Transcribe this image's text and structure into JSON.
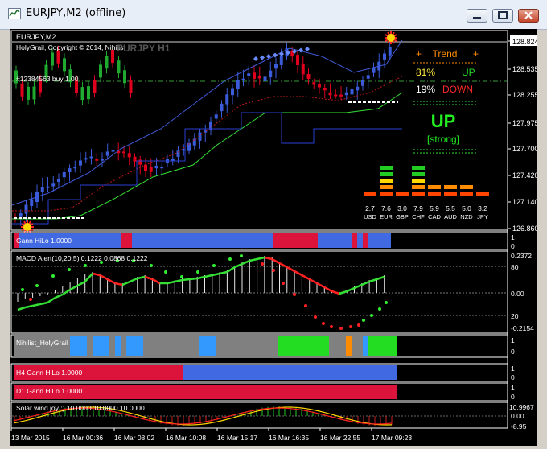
{
  "window": {
    "title": "EURJPY,M2 (offline)"
  },
  "chart_header": {
    "symbol": "EURJPY,M2",
    "indicator_label": "HolyGrail, Copyright © 2014, Nihilist",
    "watermark": "EURJPY H1",
    "order_line": "#12384563 buy 1.00"
  },
  "price_axis": {
    "labels": [
      "128.824",
      "128.535",
      "128.255",
      "127.975",
      "127.700",
      "127.420",
      "127.140",
      "126.860"
    ],
    "current_price": "128.824"
  },
  "trend_panel": {
    "title": "Trend",
    "plus": "+",
    "up_pct": "81%",
    "up_label": "UP",
    "down_pct": "19%",
    "down_label": "DOWN",
    "big_label": "UP",
    "strength": "[strong]"
  },
  "currency_strength": [
    {
      "value": "2.7",
      "ccy": "USD",
      "level": 1
    },
    {
      "value": "7.6",
      "ccy": "EUR",
      "level": 5
    },
    {
      "value": "3.0",
      "ccy": "GBP",
      "level": 1
    },
    {
      "value": "7.9",
      "ccy": "CHF",
      "level": 5
    },
    {
      "value": "5.9",
      "ccy": "CAD",
      "level": 2
    },
    {
      "value": "5.5",
      "ccy": "AUD",
      "level": 2
    },
    {
      "value": "5.0",
      "ccy": "NZD",
      "level": 2
    },
    {
      "value": "3.2",
      "ccy": "JPY",
      "level": 1
    }
  ],
  "subwindows": {
    "gann": {
      "label": "Gann HiLo 1.0000",
      "scale_top": "1",
      "scale_bottom": "0"
    },
    "macd": {
      "label": "MACD Alert(10,20,5) 0.1222 0.0868 0.1222",
      "scale": [
        "0.2372",
        "80",
        "0.00",
        "20",
        "-0.2154"
      ]
    },
    "nihilist": {
      "label": "Nihilist_HolyGrail",
      "scale_top": "1",
      "scale_bottom": "0"
    },
    "h4": {
      "label": "H4 Gann HiLo 1.0000",
      "scale_top": "1",
      "scale_bottom": "0"
    },
    "d1": {
      "label": "D1 Gann HiLo 1.0000",
      "scale_top": "1",
      "scale_bottom": "0"
    },
    "solar": {
      "label": "Solar wind joy :) 10.0000 10.0000 10.0000",
      "scale": [
        "10.9967",
        "0.00",
        "-8.95"
      ]
    }
  },
  "time_axis": [
    "13 Mar 2015",
    "16 Mar 00:36",
    "16 Mar 08:02",
    "16 Mar 10:08",
    "16 Mar 15:17",
    "16 Mar 16:35",
    "16 Mar 22:55",
    "17 Mar 09:23"
  ],
  "colors": {
    "bull": "#3b5bd9",
    "bear": "#e0001e",
    "green": "#22c55e",
    "lime": "#33e033",
    "gann_blue": "#4169e1",
    "gann_red": "#dc143c",
    "gray": "#808080",
    "sky": "#3399ff",
    "orange": "#ff8c00"
  }
}
